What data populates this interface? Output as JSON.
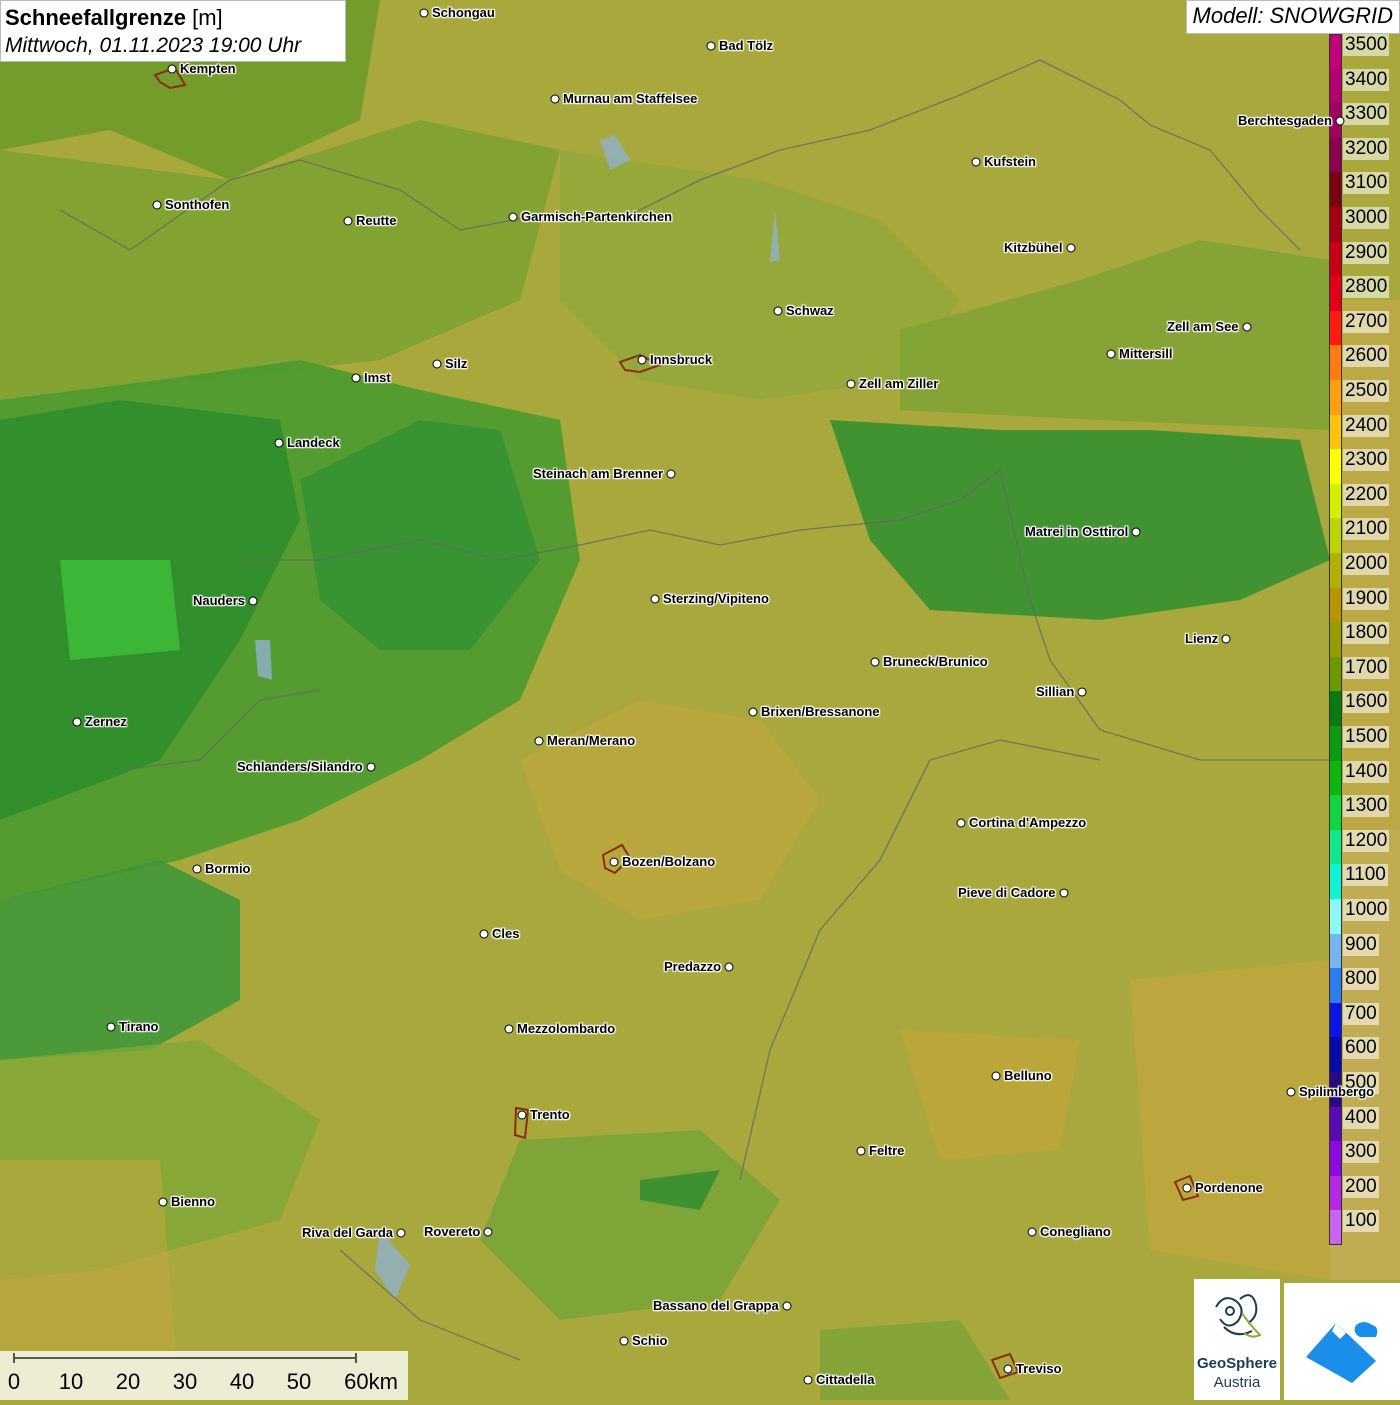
{
  "title": {
    "main": "Schneefallgrenze",
    "unit": "[m]",
    "datetime": "Mittwoch, 01.11.2023 19:00 Uhr"
  },
  "model": "Modell: SNOWGRID",
  "legend": {
    "levels": [
      {
        "label": "3500",
        "color": "#c2007a"
      },
      {
        "label": "3400",
        "color": "#b40070"
      },
      {
        "label": "3300",
        "color": "#a0005f"
      },
      {
        "label": "3200",
        "color": "#8c0050"
      },
      {
        "label": "3100",
        "color": "#7a0012"
      },
      {
        "label": "3000",
        "color": "#a50014"
      },
      {
        "label": "2900",
        "color": "#c80016"
      },
      {
        "label": "2800",
        "color": "#e3001a"
      },
      {
        "label": "2700",
        "color": "#ff1a10"
      },
      {
        "label": "2600",
        "color": "#ff7a10"
      },
      {
        "label": "2500",
        "color": "#ff9e10"
      },
      {
        "label": "2400",
        "color": "#ffc20e"
      },
      {
        "label": "2300",
        "color": "#ffff00"
      },
      {
        "label": "2200",
        "color": "#d2f000"
      },
      {
        "label": "2100",
        "color": "#bcd400"
      },
      {
        "label": "2000",
        "color": "#b2b100"
      },
      {
        "label": "1900",
        "color": "#b89500"
      },
      {
        "label": "1800",
        "color": "#969b00"
      },
      {
        "label": "1700",
        "color": "#6c9800"
      },
      {
        "label": "1600",
        "color": "#0a7a10"
      },
      {
        "label": "1500",
        "color": "#0b9a10"
      },
      {
        "label": "1400",
        "color": "#0cb60e"
      },
      {
        "label": "1300",
        "color": "#10d440"
      },
      {
        "label": "1200",
        "color": "#10e88c"
      },
      {
        "label": "1100",
        "color": "#10f4d6"
      },
      {
        "label": "1000",
        "color": "#8cf8f8"
      },
      {
        "label": "900",
        "color": "#78b4f0"
      },
      {
        "label": "800",
        "color": "#2c7ef0"
      },
      {
        "label": "700",
        "color": "#0a14e6"
      },
      {
        "label": "600",
        "color": "#0a0aa8"
      },
      {
        "label": "500",
        "color": "#280a82"
      },
      {
        "label": "400",
        "color": "#5a0ab4"
      },
      {
        "label": "300",
        "color": "#8a0ae0"
      },
      {
        "label": "200",
        "color": "#b428e6"
      },
      {
        "label": "100",
        "color": "#c864f0"
      }
    ]
  },
  "cities": [
    {
      "name": "Schongau"
    },
    {
      "name": "Kempten"
    },
    {
      "name": "Bad Tölz"
    },
    {
      "name": "Murnau am Staffelsee"
    },
    {
      "name": "Berchtesgaden"
    },
    {
      "name": "Kufstein"
    },
    {
      "name": "Sonthofen"
    },
    {
      "name": "Reutte"
    },
    {
      "name": "Garmisch-Partenkirchen"
    },
    {
      "name": "Kitzbühel"
    },
    {
      "name": "Schwaz"
    },
    {
      "name": "Zell am See"
    },
    {
      "name": "Innsbruck"
    },
    {
      "name": "Mittersill"
    },
    {
      "name": "Imst"
    },
    {
      "name": "Silz"
    },
    {
      "name": "Zell am Ziller"
    },
    {
      "name": "Landeck"
    },
    {
      "name": "Steinach am Brenner"
    },
    {
      "name": "Matrei in Osttirol"
    },
    {
      "name": "Nauders"
    },
    {
      "name": "Sterzing/Vipiteno"
    },
    {
      "name": "Lienz"
    },
    {
      "name": "Bruneck/Brunico"
    },
    {
      "name": "Sillian"
    },
    {
      "name": "Zernez"
    },
    {
      "name": "Brixen/Bressanone"
    },
    {
      "name": "Meran/Merano"
    },
    {
      "name": "Schlanders/Silandro"
    },
    {
      "name": "Cortina d'Ampezzo"
    },
    {
      "name": "Bozen/Bolzano"
    },
    {
      "name": "Bormio"
    },
    {
      "name": "Pieve di Cadore"
    },
    {
      "name": "Cles"
    },
    {
      "name": "Predazzo"
    },
    {
      "name": "Tirano"
    },
    {
      "name": "Mezzolombardo"
    },
    {
      "name": "Belluno"
    },
    {
      "name": "Spilimbergo"
    },
    {
      "name": "Trento"
    },
    {
      "name": "Feltre"
    },
    {
      "name": "Bienno"
    },
    {
      "name": "Pordenone"
    },
    {
      "name": "Riva del Garda"
    },
    {
      "name": "Rovereto"
    },
    {
      "name": "Conegliano"
    },
    {
      "name": "Bassano del Grappa"
    },
    {
      "name": "Schio"
    },
    {
      "name": "Treviso"
    },
    {
      "name": "Cittadella"
    }
  ],
  "scale": {
    "ticks": [
      "0",
      "10",
      "20",
      "30",
      "40",
      "50",
      "60km"
    ]
  },
  "logos": {
    "geosphere_line1": "GeoSphere",
    "geosphere_line2": "Austria"
  }
}
